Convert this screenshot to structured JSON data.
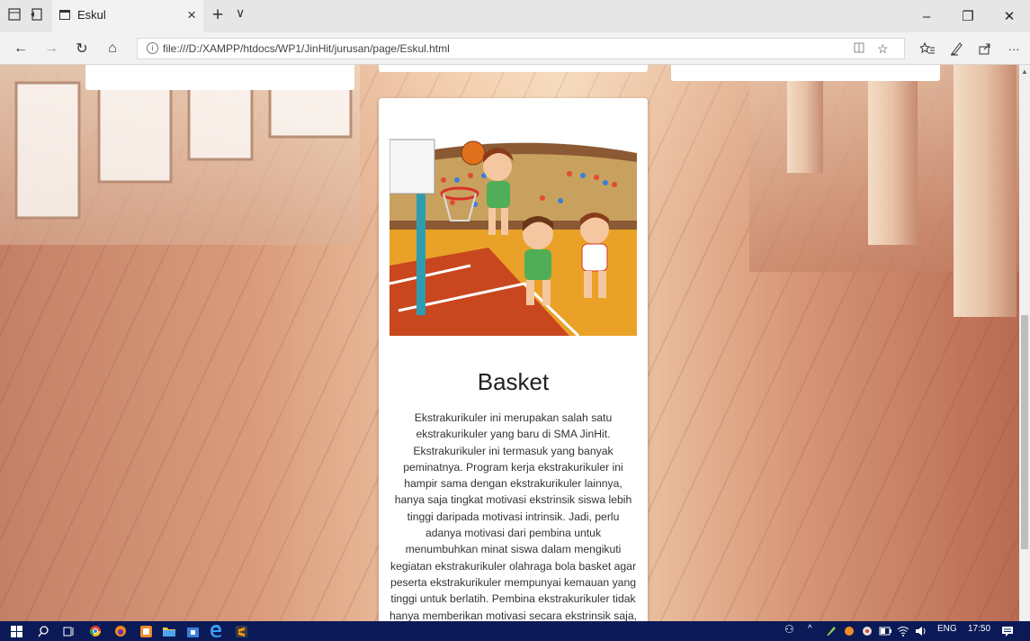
{
  "browser": {
    "tab_title": "Eskul",
    "tab_close": "×",
    "new_tab": "+",
    "tab_menu": "∨",
    "url": "file:///D:/XAMPP/htdocs/WP1/JinHit/jurusan/page/Eskul.html",
    "window": {
      "minimize": "–",
      "maximize": "❐",
      "close": "✕"
    },
    "nav": {
      "back": "←",
      "forward": "→",
      "refresh": "↻",
      "home": "⌂"
    },
    "more": "···"
  },
  "card": {
    "title": "Basket",
    "body": "Ekstrakurikuler ini merupakan salah satu ekstrakurikuler yang baru di SMA JinHit. Ekstrakurikuler ini termasuk yang banyak peminatnya. Program kerja ekstrakurikuler ini hampir sama dengan ekstrakurikuler lainnya, hanya saja tingkat motivasi ekstrinsik siswa lebih tinggi daripada motivasi intrinsik. Jadi, perlu adanya motivasi dari pembina untuk menumbuhkan minat siswa dalam mengikuti kegiatan ekstrakurikuler olahraga bola basket agar peserta ekstrakurikuler mempunyai kemauan yang tinggi untuk berlatih. Pembina ekstrakurikuler tidak hanya memberikan motivasi secara ekstrinsik saja, tetapi motivasi intrinsik juga"
  },
  "taskbar": {
    "language": "ENG",
    "time": "17:50"
  },
  "colors": {
    "taskbar": "#0b1a57",
    "chrome": "#e6e6e6"
  }
}
